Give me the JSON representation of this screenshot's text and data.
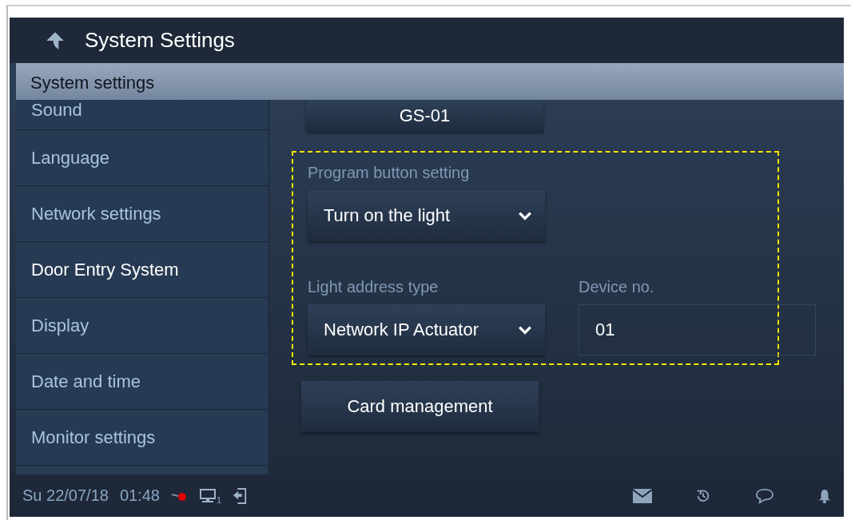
{
  "header": {
    "title": "System Settings"
  },
  "section_title": "System settings",
  "sidebar": {
    "items": [
      {
        "label": "Sound",
        "selected": false
      },
      {
        "label": "Language",
        "selected": false
      },
      {
        "label": "Network settings",
        "selected": false
      },
      {
        "label": "Door Entry System",
        "selected": true
      },
      {
        "label": "Display",
        "selected": false
      },
      {
        "label": "Date and time",
        "selected": false
      },
      {
        "label": "Monitor settings",
        "selected": false
      }
    ]
  },
  "content": {
    "device_button": "GS-01",
    "program_button": {
      "label": "Program button setting",
      "value": "Turn on the light"
    },
    "light_address_type": {
      "label": "Light address type",
      "value": "Network IP Actuator"
    },
    "device_no": {
      "label": "Device no.",
      "value": "01"
    },
    "card_management_button": "Card management"
  },
  "status_bar": {
    "date": "Su 22/07/18",
    "time": "01:48",
    "monitor_count": "1"
  }
}
